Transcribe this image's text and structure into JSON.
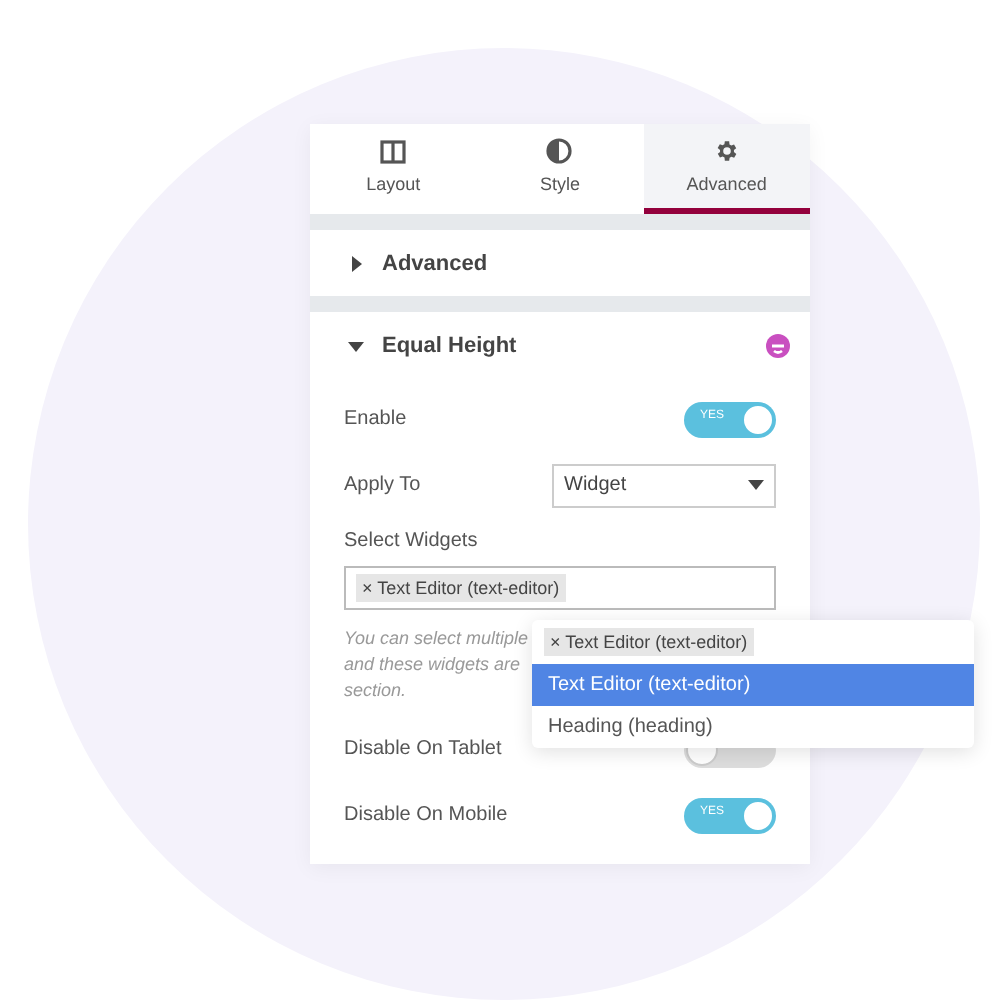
{
  "tabs": [
    {
      "label": "Layout",
      "selected": false
    },
    {
      "label": "Style",
      "selected": false
    },
    {
      "label": "Advanced",
      "selected": true
    }
  ],
  "sections": [
    {
      "title": "Advanced",
      "expanded": false
    },
    {
      "title": "Equal Height",
      "expanded": true
    }
  ],
  "controls": [
    {
      "kind": "toggle",
      "label": "Enable",
      "on": true,
      "toggle_text": "YES"
    },
    {
      "kind": "select",
      "label": "Apply To",
      "value": "Widget"
    },
    {
      "kind": "tags",
      "label": "Select Widgets",
      "tags": [
        "× Text Editor (text-editor)"
      ]
    },
    {
      "kind": "help",
      "lines": [
        "You can select multiple",
        "and these widgets are",
        "section."
      ]
    },
    {
      "kind": "toggle",
      "label": "Disable On Tablet",
      "on": false
    },
    {
      "kind": "toggle",
      "label": "Disable On Mobile",
      "on": true,
      "toggle_text": "YES"
    }
  ],
  "dropdown": {
    "tags": [
      "× Text Editor (text-editor)"
    ],
    "options": [
      {
        "label": "Text Editor (text-editor)",
        "selected": true
      },
      {
        "label": "Heading (heading)",
        "selected": false
      }
    ]
  }
}
